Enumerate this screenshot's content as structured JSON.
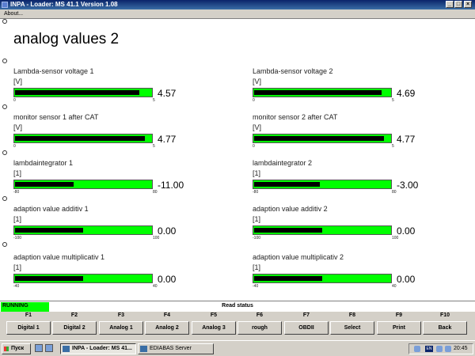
{
  "window": {
    "title": "INPA - Loader:  MS 41.1 Version 1.08"
  },
  "menu": {
    "about": "About..."
  },
  "page": {
    "title": "analog values 2"
  },
  "gauges": [
    {
      "label": "Lambda-sensor voltage 1",
      "unit": "[V]",
      "min": "0",
      "max": "5",
      "value": "4.57",
      "fill_fraction": 0.914
    },
    {
      "label": "Lambda-sensor voltage 2",
      "unit": "[V]",
      "min": "0",
      "max": "5",
      "value": "4.69",
      "fill_fraction": 0.938
    },
    {
      "label": "monitor sensor 1   after CAT",
      "unit": "[V]",
      "min": "0",
      "max": "5",
      "value": "4.77",
      "fill_fraction": 0.954
    },
    {
      "label": "monitor sensor 2   after CAT",
      "unit": "[V]",
      "min": "0",
      "max": "5",
      "value": "4.77",
      "fill_fraction": 0.954
    },
    {
      "label": "lambdaintegrator 1",
      "unit": "[1]",
      "min": "-80",
      "max": "80",
      "value": "-11.00",
      "fill_fraction": 0.43
    },
    {
      "label": "lambdaintegrator 2",
      "unit": "[1]",
      "min": "-80",
      "max": "80",
      "value": "-3.00",
      "fill_fraction": 0.48
    },
    {
      "label": "adaption value additiv 1",
      "unit": "[1]",
      "min": "-100",
      "max": "100",
      "value": "0.00",
      "fill_fraction": 0.5
    },
    {
      "label": "adaption value additiv 2",
      "unit": "[1]",
      "min": "-100",
      "max": "100",
      "value": "0.00",
      "fill_fraction": 0.5
    },
    {
      "label": "adaption value multiplicativ 1",
      "unit": "[1]",
      "min": "-40",
      "max": "40",
      "value": "0.00",
      "fill_fraction": 0.5
    },
    {
      "label": "adaption value multiplicativ 2",
      "unit": "[1]",
      "min": "-40",
      "max": "40",
      "value": "0.00",
      "fill_fraction": 0.5
    }
  ],
  "status": {
    "running": "RUNNING",
    "read_status": "Read status"
  },
  "fkeys": [
    {
      "key": "F1",
      "label": "Digital 1"
    },
    {
      "key": "F2",
      "label": "Digital 2"
    },
    {
      "key": "F3",
      "label": "Analog 1"
    },
    {
      "key": "F4",
      "label": "Analog 2"
    },
    {
      "key": "F5",
      "label": "Analog 3"
    },
    {
      "key": "F6",
      "label": "rough"
    },
    {
      "key": "F7",
      "label": "OBDII"
    },
    {
      "key": "F8",
      "label": "Select"
    },
    {
      "key": "F9",
      "label": "Print"
    },
    {
      "key": "F10",
      "label": "Back"
    }
  ],
  "taskbar": {
    "start_label": "Пуск",
    "tasks": [
      {
        "label": "INPA - Loader:  MS 41..."
      },
      {
        "label": "EDIABAS Server"
      }
    ],
    "language": "EN",
    "clock": "20:45"
  },
  "colors": {
    "bar_green": "#00ff00",
    "bar_fill": "#000000",
    "title_blue": "#0a246a"
  }
}
